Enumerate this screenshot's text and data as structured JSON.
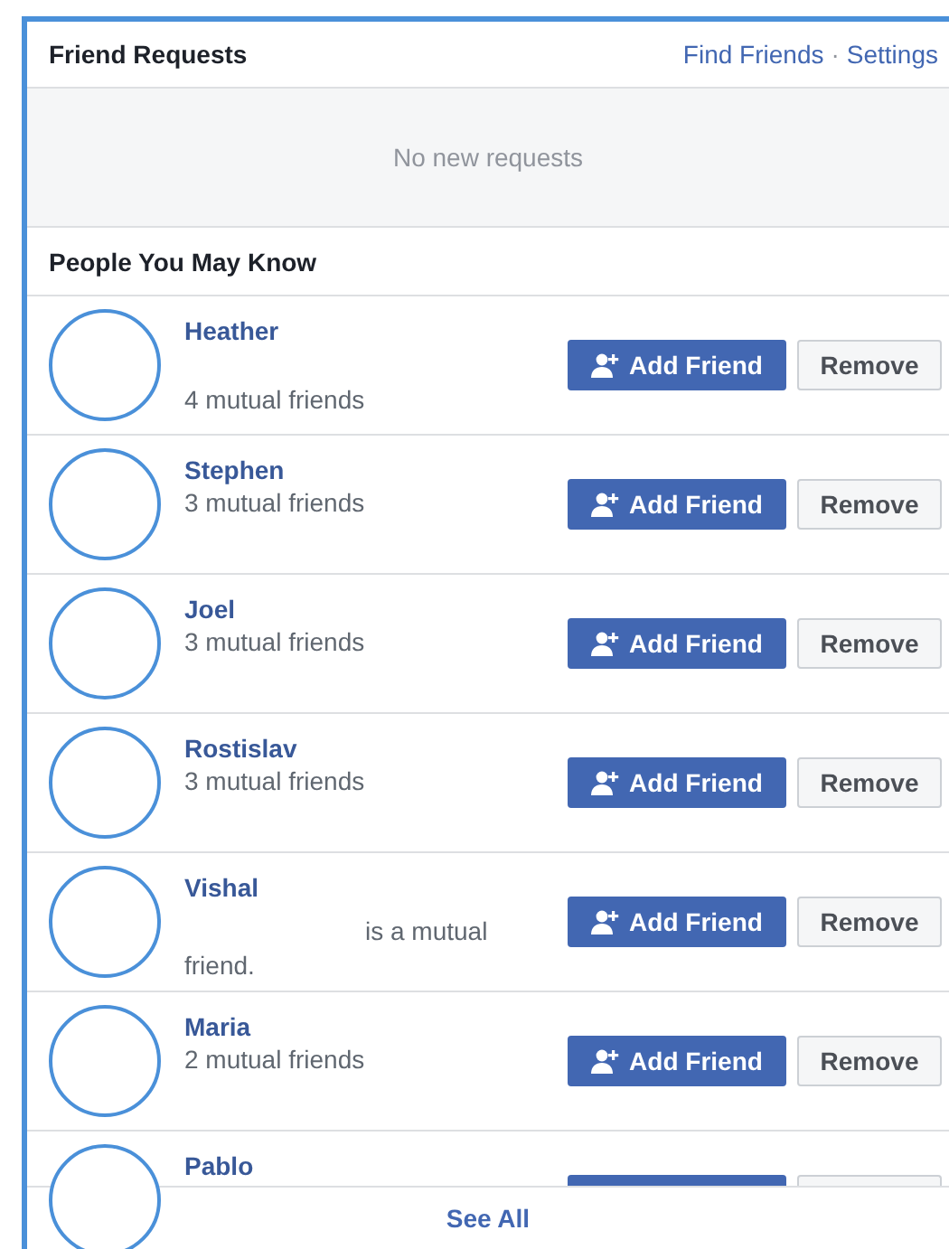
{
  "header": {
    "title": "Friend Requests",
    "links": [
      "Find Friends",
      "Settings"
    ],
    "separator": "·"
  },
  "requests": {
    "empty_message": "No new requests"
  },
  "suggestions": {
    "title": "People You May Know",
    "people": [
      {
        "name": "Heather",
        "mutual": "4 mutual friends",
        "spaced": true,
        "buttons": [
          {
            "kind": "add",
            "label": "Add Friend"
          },
          {
            "kind": "remove",
            "label": "Remove"
          }
        ]
      },
      {
        "name": "Stephen",
        "mutual": "3 mutual friends",
        "buttons": [
          {
            "kind": "add",
            "label": "Add Friend"
          },
          {
            "kind": "remove",
            "label": "Remove"
          }
        ]
      },
      {
        "name": "Joel",
        "mutual": "3 mutual friends",
        "buttons": [
          {
            "kind": "add",
            "label": "Add Friend"
          },
          {
            "kind": "remove",
            "label": "Remove"
          }
        ]
      },
      {
        "name": "Rostislav",
        "mutual": "3 mutual friends",
        "buttons": [
          {
            "kind": "add",
            "label": "Add Friend"
          },
          {
            "kind": "remove",
            "label": "Remove"
          }
        ]
      },
      {
        "name": "Vishal",
        "mutual": "is a mutual friend.",
        "redacted_prefix": true,
        "buttons": [
          {
            "kind": "add",
            "label": "Add Friend"
          },
          {
            "kind": "remove",
            "label": "Remove"
          }
        ]
      },
      {
        "name": "Maria",
        "mutual": "2 mutual friends",
        "buttons": [
          {
            "kind": "add",
            "label": "Add Friend"
          },
          {
            "kind": "remove",
            "label": "Remove"
          }
        ]
      },
      {
        "name": "Pablo",
        "buttons": [
          {
            "kind": "add"
          },
          {
            "kind": "remove"
          }
        ]
      }
    ],
    "footer_link": "See All"
  }
}
